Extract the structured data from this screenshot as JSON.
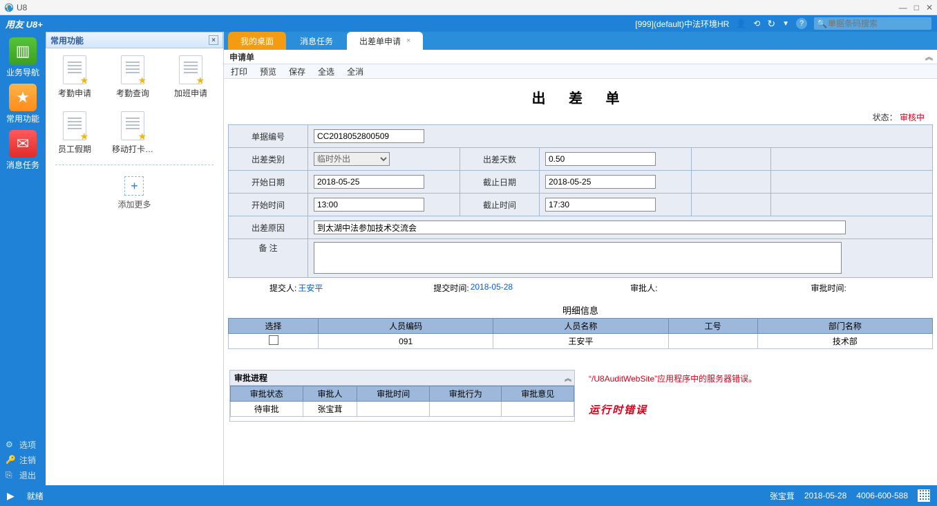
{
  "window": {
    "title": "U8"
  },
  "topbar": {
    "logo": "用友 U8+",
    "org": "[999](default)中法环境HR",
    "search_placeholder": "单据条码搜索"
  },
  "leftrail": {
    "nav": "业务导航",
    "fav": "常用功能",
    "msg": "消息任务",
    "options": "选项",
    "logout": "注销",
    "exit": "退出"
  },
  "favorites": {
    "title": "常用功能",
    "items": [
      "考勤申请",
      "考勤查询",
      "加班申请",
      "员工假期",
      "移动打卡…"
    ],
    "addmore": "添加更多"
  },
  "tabs": {
    "t1": "我的桌面",
    "t2": "消息任务",
    "t3": "出差单申请"
  },
  "subheader": "申请单",
  "toolbar": {
    "print": "打印",
    "preview": "预览",
    "save": "保存",
    "selectall": "全选",
    "deselect": "全消"
  },
  "form": {
    "title": "出 差 单",
    "status_label": "状态：",
    "status_value": "审核中",
    "doc_no_label": "单据编号",
    "doc_no": "CC2018052800509",
    "type_label": "出差类别",
    "type": "临时外出",
    "days_label": "出差天数",
    "days": "0.50",
    "start_date_label": "开始日期",
    "start_date": "2018-05-25",
    "end_date_label": "截止日期",
    "end_date": "2018-05-25",
    "start_time_label": "开始时间",
    "start_time": "13:00",
    "end_time_label": "截止时间",
    "end_time": "17:30",
    "reason_label": "出差原因",
    "reason": "到太湖中法参加技术交流会",
    "remark_label": "备    注",
    "remark": "",
    "submitter_label": "提交人:",
    "submitter": "王安平",
    "submit_time_label": "提交时间:",
    "submit_time": "2018-05-28",
    "approver_label": "审批人:",
    "approver": "",
    "approve_time_label": "审批时间:",
    "approve_time": ""
  },
  "detail": {
    "title": "明细信息",
    "cols": {
      "sel": "选择",
      "code": "人员编码",
      "name": "人员名称",
      "emp": "工号",
      "dept": "部门名称"
    },
    "row": {
      "code": "091",
      "name": "王安平",
      "emp": "",
      "dept": "技术部"
    }
  },
  "approval": {
    "title": "审批进程",
    "cols": {
      "status": "审批状态",
      "person": "审批人",
      "time": "审批时间",
      "action": "审批行为",
      "opinion": "审批意见"
    },
    "row": {
      "status": "待审批",
      "person": "张宝茸",
      "time": "",
      "action": "",
      "opinion": ""
    }
  },
  "error": {
    "line1": "“/U8AuditWebSite”应用程序中的服务器错误。",
    "line2": "运行时错误"
  },
  "statusbar": {
    "ready": "就绪",
    "user": "张宝茸",
    "date": "2018-05-28",
    "phone": "4006-600-588"
  }
}
